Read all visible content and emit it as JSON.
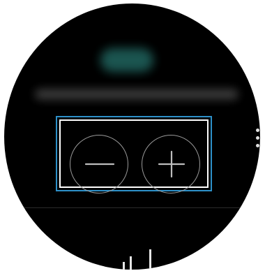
{
  "screen": {
    "title_text": "",
    "subtitle_text": ""
  },
  "controls": {
    "decrease_icon": "minus-icon",
    "increase_icon": "plus-icon",
    "highlight_color": "#2d90c8"
  },
  "more_options": {
    "icon": "more-vertical-icon"
  },
  "colors": {
    "background": "#000000",
    "title_blur": "#1d5a55",
    "button_outline": "#9a9a9a"
  }
}
